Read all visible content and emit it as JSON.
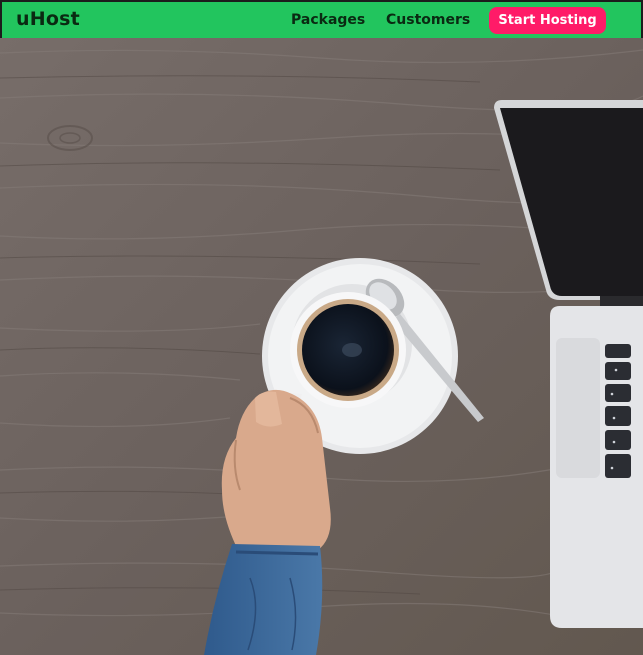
{
  "header": {
    "brand": "uHost",
    "nav": {
      "packages": "Packages",
      "customers": "Customers"
    },
    "cta_label": "Start Hosting"
  },
  "colors": {
    "header_bg": "#22c55e",
    "cta_bg": "#ff1b68",
    "brand_text": "#0a2a12"
  },
  "hero": {
    "image": "photo of wooden desk with coffee cup, saucer, spoon, hand and laptop"
  }
}
